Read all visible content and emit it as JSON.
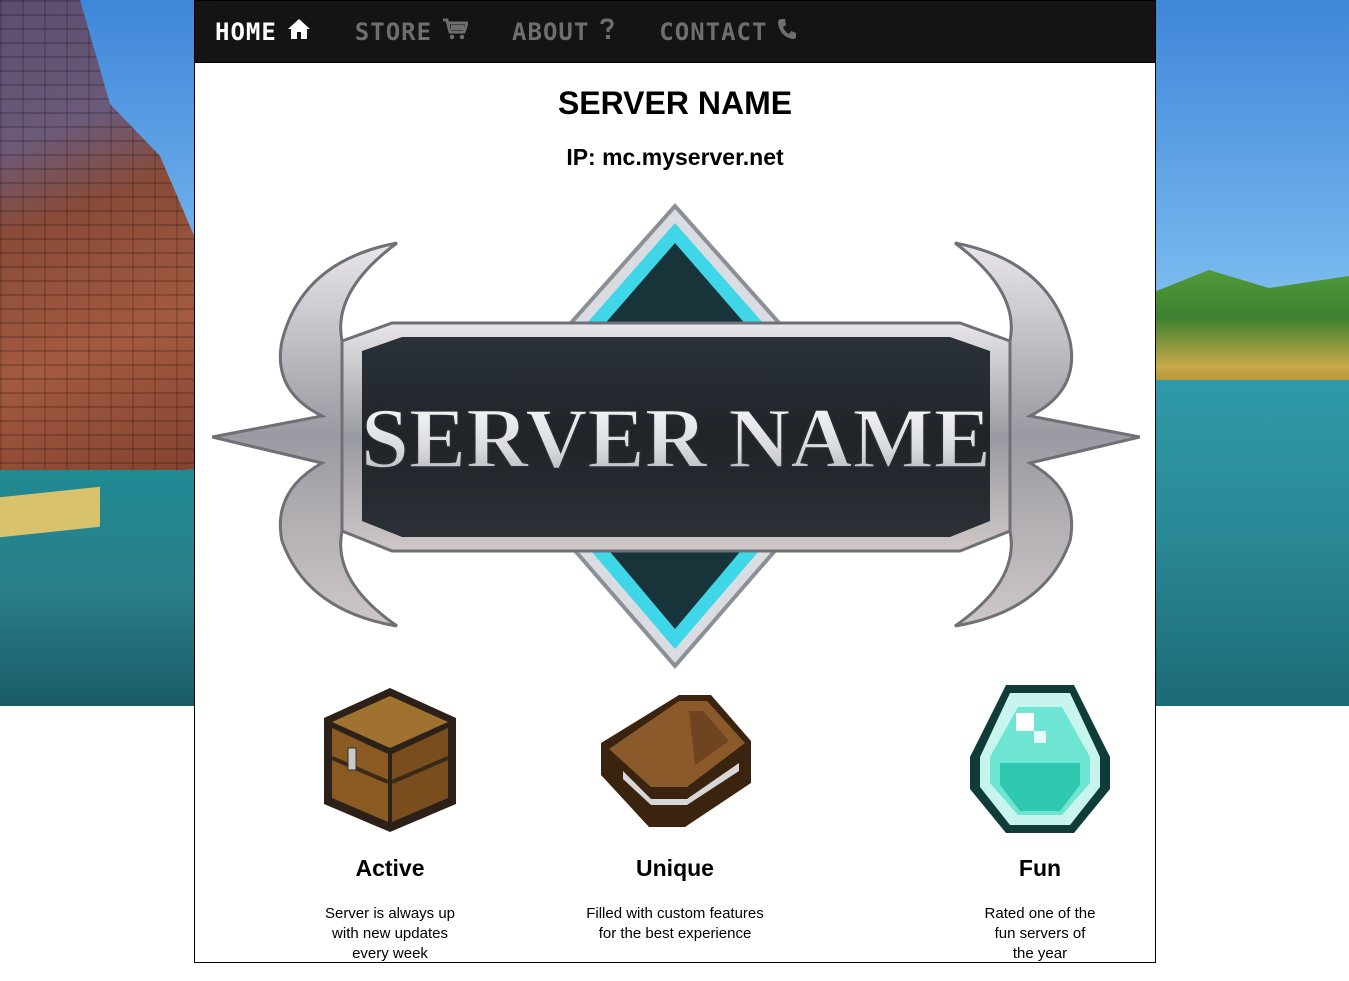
{
  "nav": {
    "items": [
      {
        "label": "HOME",
        "icon": "home-icon",
        "active": true
      },
      {
        "label": "STORE",
        "icon": "cart-icon",
        "active": false
      },
      {
        "label": "ABOUT",
        "icon": "question-icon",
        "active": false
      },
      {
        "label": "CONTACT",
        "icon": "phone-icon",
        "active": false
      }
    ]
  },
  "header": {
    "title": "SERVER NAME",
    "ip": "IP: mc.myserver.net"
  },
  "logo": {
    "text": "SERVER NAME"
  },
  "features": [
    {
      "title": "Active",
      "icon": "chest-icon",
      "lines": [
        "Server is always up",
        "with new updates",
        "every week"
      ]
    },
    {
      "title": "Unique",
      "icon": "book-icon",
      "lines": [
        "Filled with custom features",
        "for the best experience"
      ]
    },
    {
      "title": "Fun",
      "icon": "diamond-icon",
      "lines": [
        "Rated one of the",
        "fun servers of",
        "the year"
      ]
    }
  ],
  "colors": {
    "nav_bg": "#141414",
    "nav_active": "#ffffff",
    "nav_inactive": "#6e6e6e",
    "logo_accent": "#3fd6e8"
  }
}
